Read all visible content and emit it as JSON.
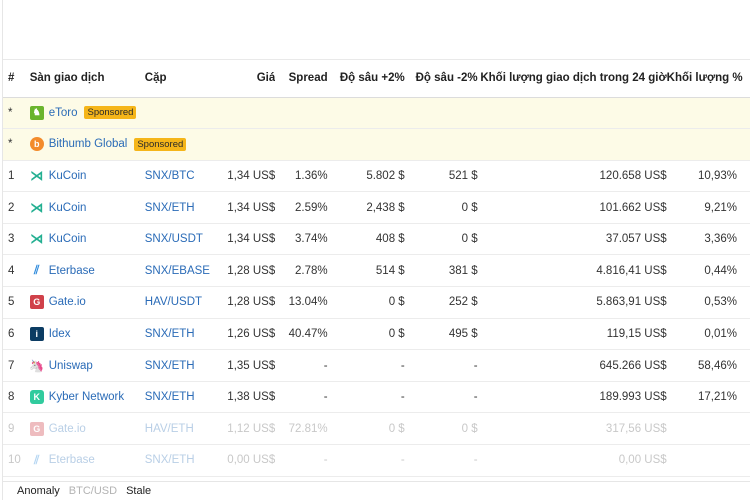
{
  "headers": {
    "rank": "#",
    "exchange": "Sàn giao dịch",
    "pair": "Cặp",
    "price": "Giá",
    "spread": "Spread",
    "depth_plus": "Độ sâu +2%",
    "depth_minus": "Độ sâu -2%",
    "volume_24h": "Khối lượng giao dịch trong 24 giờ",
    "volume_pct": "Khối lượng %"
  },
  "sponsored": [
    {
      "rank": "*",
      "exchange": "eToro",
      "logo": "etoro-logo-icon",
      "badge": "Sponsored"
    },
    {
      "rank": "*",
      "exchange": "Bithumb Global",
      "logo": "bithumb-logo-icon",
      "badge": "Sponsored"
    }
  ],
  "rows": [
    {
      "rank": "1",
      "exchange": "KuCoin",
      "logo": "kucoin",
      "pair": "SNX/BTC",
      "price": "1,34 US$",
      "spread": "1.36%",
      "depth_plus": "5.802 $",
      "depth_minus": "521 $",
      "volume": "120.658 US$",
      "volume_pct": "10,93%"
    },
    {
      "rank": "2",
      "exchange": "KuCoin",
      "logo": "kucoin",
      "pair": "SNX/ETH",
      "price": "1,34 US$",
      "spread": "2.59%",
      "depth_plus": "2,438 $",
      "depth_minus": "0 $",
      "volume": "101.662 US$",
      "volume_pct": "9,21%"
    },
    {
      "rank": "3",
      "exchange": "KuCoin",
      "logo": "kucoin",
      "pair": "SNX/USDT",
      "price": "1,34 US$",
      "spread": "3.74%",
      "depth_plus": "408 $",
      "depth_minus": "0 $",
      "volume": "37.057 US$",
      "volume_pct": "3,36%"
    },
    {
      "rank": "4",
      "exchange": "Eterbase",
      "logo": "eterbase",
      "pair": "SNX/EBASE",
      "price": "1,28 US$",
      "spread": "2.78%",
      "depth_plus": "514 $",
      "depth_minus": "381 $",
      "volume": "4.816,41 US$",
      "volume_pct": "0,44%"
    },
    {
      "rank": "5",
      "exchange": "Gate.io",
      "logo": "gate",
      "pair": "HAV/USDT",
      "price": "1,28 US$",
      "spread": "13.04%",
      "depth_plus": "0 $",
      "depth_minus": "252 $",
      "volume": "5.863,91 US$",
      "volume_pct": "0,53%"
    },
    {
      "rank": "6",
      "exchange": "Idex",
      "logo": "idex",
      "pair": "SNX/ETH",
      "price": "1,26 US$",
      "spread": "40.47%",
      "depth_plus": "0 $",
      "depth_minus": "495 $",
      "volume": "119,15 US$",
      "volume_pct": "0,01%"
    },
    {
      "rank": "7",
      "exchange": "Uniswap",
      "logo": "uniswap",
      "pair": "SNX/ETH",
      "price": "1,35 US$",
      "spread": "-",
      "depth_plus": "-",
      "depth_minus": "-",
      "volume": "645.266 US$",
      "volume_pct": "58,46%"
    },
    {
      "rank": "8",
      "exchange": "Kyber Network",
      "logo": "kyber",
      "pair": "SNX/ETH",
      "price": "1,38 US$",
      "spread": "-",
      "depth_plus": "-",
      "depth_minus": "-",
      "volume": "189.993 US$",
      "volume_pct": "17,21%"
    },
    {
      "rank": "9",
      "exchange": "Gate.io",
      "logo": "gate",
      "pair": "HAV/ETH",
      "price": "1,12 US$",
      "spread": "72.81%",
      "depth_plus": "0 $",
      "depth_minus": "0 $",
      "volume": "317,56 US$",
      "volume_pct": ""
    },
    {
      "rank": "10",
      "exchange": "Eterbase",
      "logo": "eterbase",
      "pair": "SNX/ETH",
      "price": "0,00 US$",
      "spread": "-",
      "depth_plus": "-",
      "depth_minus": "-",
      "volume": "0,00 US$",
      "volume_pct": ""
    }
  ],
  "footer": {
    "tab_anomaly": "Anomaly",
    "tab_btc_usd": "BTC/USD",
    "tab_stale": "Stale"
  },
  "colors": {
    "link": "#2a6bb7",
    "sponsored_bg": "#fdfbe7",
    "badge_bg": "#f5b519"
  }
}
